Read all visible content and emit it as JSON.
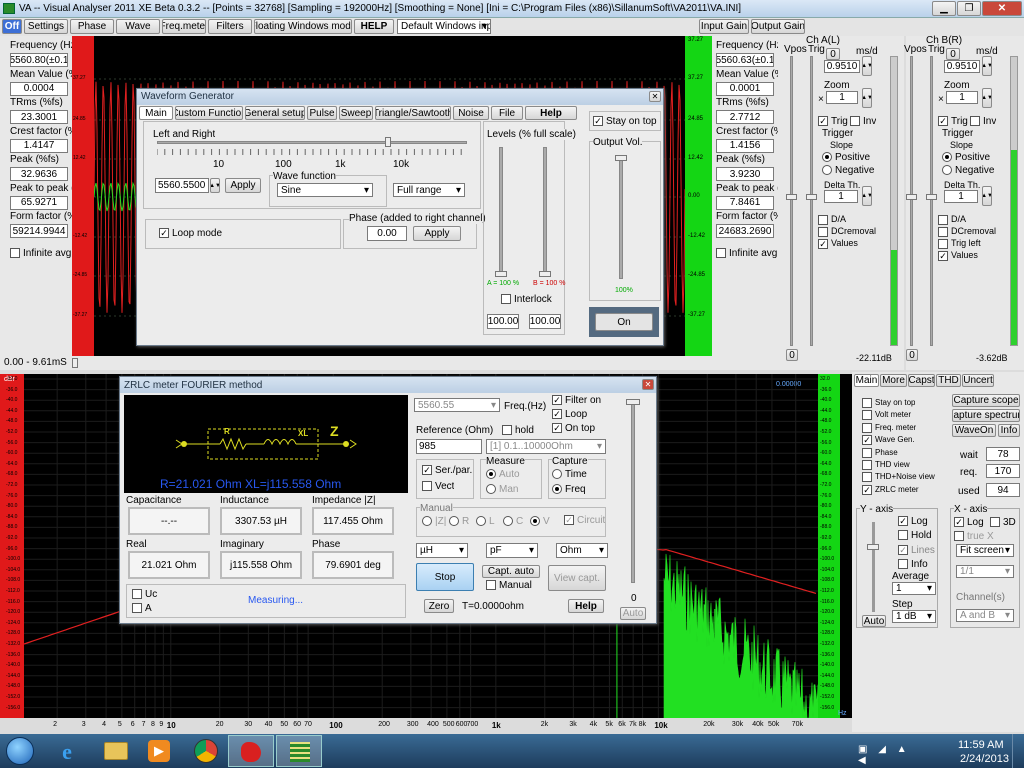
{
  "title": "VA -- Visual Analyser 2011 XE Beta 0.3.2 --  [Points = 32768]  [Sampling = 192000Hz]  [Smoothing = None]  [Ini = C:\\Program Files (x86)\\SillanumSoft\\VA2011\\VA.INI]",
  "toolbar": {
    "off": "Off",
    "items": [
      "Settings",
      "Phase",
      "Wave",
      "Freq.meter",
      "Filters",
      "Floating Windows mode",
      "HELP"
    ],
    "layout": "Default Windows inp",
    "input_gain": "Input Gain",
    "output_gain": "Output Gain"
  },
  "left_stats": [
    {
      "label": "Frequency (Hz)",
      "value": "5560.80(±0.1"
    },
    {
      "label": "Mean Value (%",
      "value": "0.0004"
    },
    {
      "label": "TRms (%fs)",
      "value": "23.3001"
    },
    {
      "label": "Crest factor (%",
      "value": "1.4147"
    },
    {
      "label": "Peak (%fs)",
      "value": "32.9636"
    },
    {
      "label": "Peak to peak (",
      "value": "65.9271"
    },
    {
      "label": "Form factor (%f",
      "value": "59214.9944"
    }
  ],
  "right_stats": [
    {
      "label": "Frequency (Hz)",
      "value": "5560.63(±0.1"
    },
    {
      "label": "Mean Value (%",
      "value": "0.0001"
    },
    {
      "label": "TRms (%fs)",
      "value": "2.7712"
    },
    {
      "label": "Crest factor (%f",
      "value": "1.4156"
    },
    {
      "label": "Peak (%fs)",
      "value": "3.9230"
    },
    {
      "label": "Peak to peak (",
      "value": "7.8461"
    },
    {
      "label": "Form factor (%f",
      "value": "24683.2690"
    }
  ],
  "infinite_avg": "Infinite avg",
  "time_range": "0.00 - 9.61mS",
  "scope_right_ticks": [
    "37.27",
    "24.85",
    "12.42",
    "0.00",
    "-12.42",
    "-24.85",
    "-37.27"
  ],
  "scope_left_ticks": [
    "37.27",
    "24.85",
    "12.42",
    "",
    "-12.42",
    "-24.85",
    "-37.27"
  ],
  "scope_top_right": "37.27",
  "channels": [
    {
      "title": "Ch A(L)",
      "vpos": "Vpos",
      "trig": "Trig",
      "ms_label": "ms/d",
      "ms_value": "0.9510",
      "zero": "0",
      "zoom_label": "Zoom",
      "zoom_value": "1",
      "trig_cb": "Trig",
      "inv": "Inv",
      "trigger": "Trigger",
      "slope": "Slope",
      "positive": "Positive",
      "negative": "Negative",
      "delta": "Delta Th.",
      "delta_value": "1",
      "options": [
        "D/A",
        "DCremoval",
        "Values"
      ],
      "db": "-22.11dB",
      "bottom_zero": "0"
    },
    {
      "title": "Ch B(R)",
      "vpos": "Vpos",
      "trig": "Trig",
      "ms_label": "ms/d",
      "ms_value": "0.9510",
      "zero": "0",
      "zoom_label": "Zoom",
      "zoom_value": "1",
      "trig_cb": "Trig",
      "inv": "Inv",
      "trigger": "Trigger",
      "slope": "Slope",
      "positive": "Positive",
      "negative": "Negative",
      "delta": "Delta Th.",
      "delta_value": "1",
      "options": [
        "D/A",
        "DCremoval",
        "Trig left",
        "Values"
      ],
      "db": "-3.62dB",
      "bottom_zero": "0"
    }
  ],
  "waveform": {
    "title": "Waveform Generator",
    "tabs": [
      "Main",
      "Custom Function",
      "General setup",
      "Pulse",
      "Sweep",
      "Triangle/Sawtooth",
      "Noise",
      "File",
      "Help"
    ],
    "left_and_right": "Left and  Right",
    "freq_ticks": [
      "10",
      "100",
      "1k",
      "10k"
    ],
    "freq_value": "5560.5500",
    "apply": "Apply",
    "wave_function": "Wave function",
    "wave": "Sine",
    "range": "Full range",
    "loop_mode": "Loop mode",
    "phase_label": "Phase (added to right channel)",
    "phase_value": "0.00",
    "phase_apply": "Apply",
    "levels": "Levels (% full scale)",
    "level_a": "A = 100 %",
    "level_b": "B = 100 %",
    "interlock": "Interlock",
    "level_a_value": "100.00",
    "level_b_value": "100.00",
    "stay_on_top": "Stay on top",
    "output_vol": "Output Vol.",
    "output_pct": "100%",
    "on": "On"
  },
  "zrlc": {
    "title": "ZRLC meter FOURIER method",
    "circuit_r": "R",
    "circuit_xl": "XL",
    "circuit_z": "Z",
    "readout": "R=21.021 Ohm  XL=j115.558 Ohm",
    "cap_label": "Capacitance",
    "cap_value": "--.--",
    "ind_label": "Inductance",
    "ind_value": "3307.53 µH",
    "imp_label": "Impedance |Z|",
    "imp_value": "117.455 Ohm",
    "real_label": "Real",
    "real_value": "21.021 Ohm",
    "imag_label": "Imaginary",
    "imag_value": "j115.558 Ohm",
    "phase_label": "Phase",
    "phase_value": "79.6901 deg",
    "uc": "Uc",
    "a": "A",
    "measuring": "Measuring...",
    "freq_value": "5560.55",
    "freq_label": "Freq.(Hz)",
    "filter_on": "Filter on",
    "loop": "Loop",
    "on_top": "On top",
    "reference": "Reference (Ohm)",
    "hold": "hold",
    "ref_value": "985",
    "ref_range": "[1] 0.1..10000Ohm",
    "ser_par": "Ser./par.",
    "vect": "Vect",
    "measure": "Measure",
    "auto": "Auto",
    "man": "Man",
    "capture": "Capture",
    "time": "Time",
    "freq": "Freq",
    "manual": "Manual",
    "manual_opts": [
      "|Z|",
      "R",
      "L",
      "C",
      "V"
    ],
    "circuit": "Circuit",
    "unit_h": "µH",
    "unit_f": "pF",
    "unit_o": "Ohm",
    "stop": "Stop",
    "capt_auto": "Capt. auto",
    "manual_cb": "Manual",
    "view_capt": "View capt.",
    "zero": "Zero",
    "t_value": "T=0.0000ohm",
    "help": "Help",
    "slider_zero": "0",
    "slider_auto": "Auto"
  },
  "spectrum": {
    "db_label": "dBr",
    "left_ticks": [
      "-32.0",
      "-36.0",
      "-40.0",
      "-44.0",
      "-48.0",
      "-52.0",
      "-56.0",
      "-60.0",
      "-64.0",
      "-68.0",
      "-72.0",
      "-76.0",
      "-80.0",
      "-84.0",
      "-88.0",
      "-92.0",
      "-96.0",
      "-100.0",
      "-104.0",
      "-108.0",
      "-112.0",
      "-116.0",
      "-120.0",
      "-124.0",
      "-128.0",
      "-132.0",
      "-136.0",
      "-140.0",
      "-144.0",
      "-148.0",
      "-152.0",
      "-156.0"
    ],
    "right_ticks": [
      "32.0",
      "-36.0",
      "-40.0",
      "-44.0",
      "-48.0",
      "-52.0",
      "-56.0",
      "-60.0",
      "-64.0",
      "-68.0",
      "-72.0",
      "-76.0",
      "-80.0",
      "-84.0",
      "-88.0",
      "-92.0",
      "-96.0",
      "-100.0",
      "-104.0",
      "-108.0",
      "-112.0",
      "-116.0",
      "-120.0",
      "-124.0",
      "-128.0",
      "-132.0",
      "-136.0",
      "-140.0",
      "-144.0",
      "-148.0",
      "-152.0",
      "-156.0"
    ],
    "top_value": "0.00000",
    "x_ticks": [
      "2",
      "3",
      "4",
      "5",
      "6",
      "7",
      "8",
      "9",
      "10",
      "20",
      "30",
      "40",
      "50",
      "60",
      "70",
      "100",
      "200",
      "300",
      "400",
      "500",
      "600",
      "700",
      "1k",
      "2k",
      "3k",
      "4k",
      "5k",
      "6k",
      "7k",
      "8k",
      "10k",
      "20k",
      "30k",
      "40k",
      "50k",
      "70k"
    ],
    "x_unit": "Hz"
  },
  "side": {
    "tabs": [
      "Main",
      "More",
      "Capst",
      "THD",
      "Uncert"
    ],
    "checks": [
      {
        "label": "Stay on top",
        "on": false
      },
      {
        "label": "Volt meter",
        "on": false
      },
      {
        "label": "Freq. meter",
        "on": false
      },
      {
        "label": "Wave Gen.",
        "on": true
      },
      {
        "label": "Phase",
        "on": false
      },
      {
        "label": "THD view",
        "on": false
      },
      {
        "label": "THD+Noise view",
        "on": false
      },
      {
        "label": "ZRLC meter",
        "on": true
      }
    ],
    "capture_scope": "Capture scope",
    "capture_spectrum": "Capture spectrum",
    "waveon": "WaveOn",
    "info": "Info",
    "wait_label": "wait",
    "wait_value": "78",
    "req_label": "req.",
    "req_value": "170",
    "used_label": "used",
    "used_value": "94",
    "y_axis": "Y - axis",
    "log": "Log",
    "hold": "Hold",
    "lines": "Lines",
    "info_cb": "Info",
    "average": "Average",
    "average_value": "1",
    "step": "Step",
    "step_value": "1 dB",
    "auto": "Auto",
    "x_axis": "X - axis",
    "x_log": "Log",
    "three_d": "3D",
    "true_x": "true X",
    "fit": "Fit screen",
    "ratio": "1/1",
    "channels_label": "Channel(s)",
    "channels_value": "A and B"
  },
  "taskbar": {
    "time": "11:59 AM",
    "date": "2/24/2013"
  }
}
